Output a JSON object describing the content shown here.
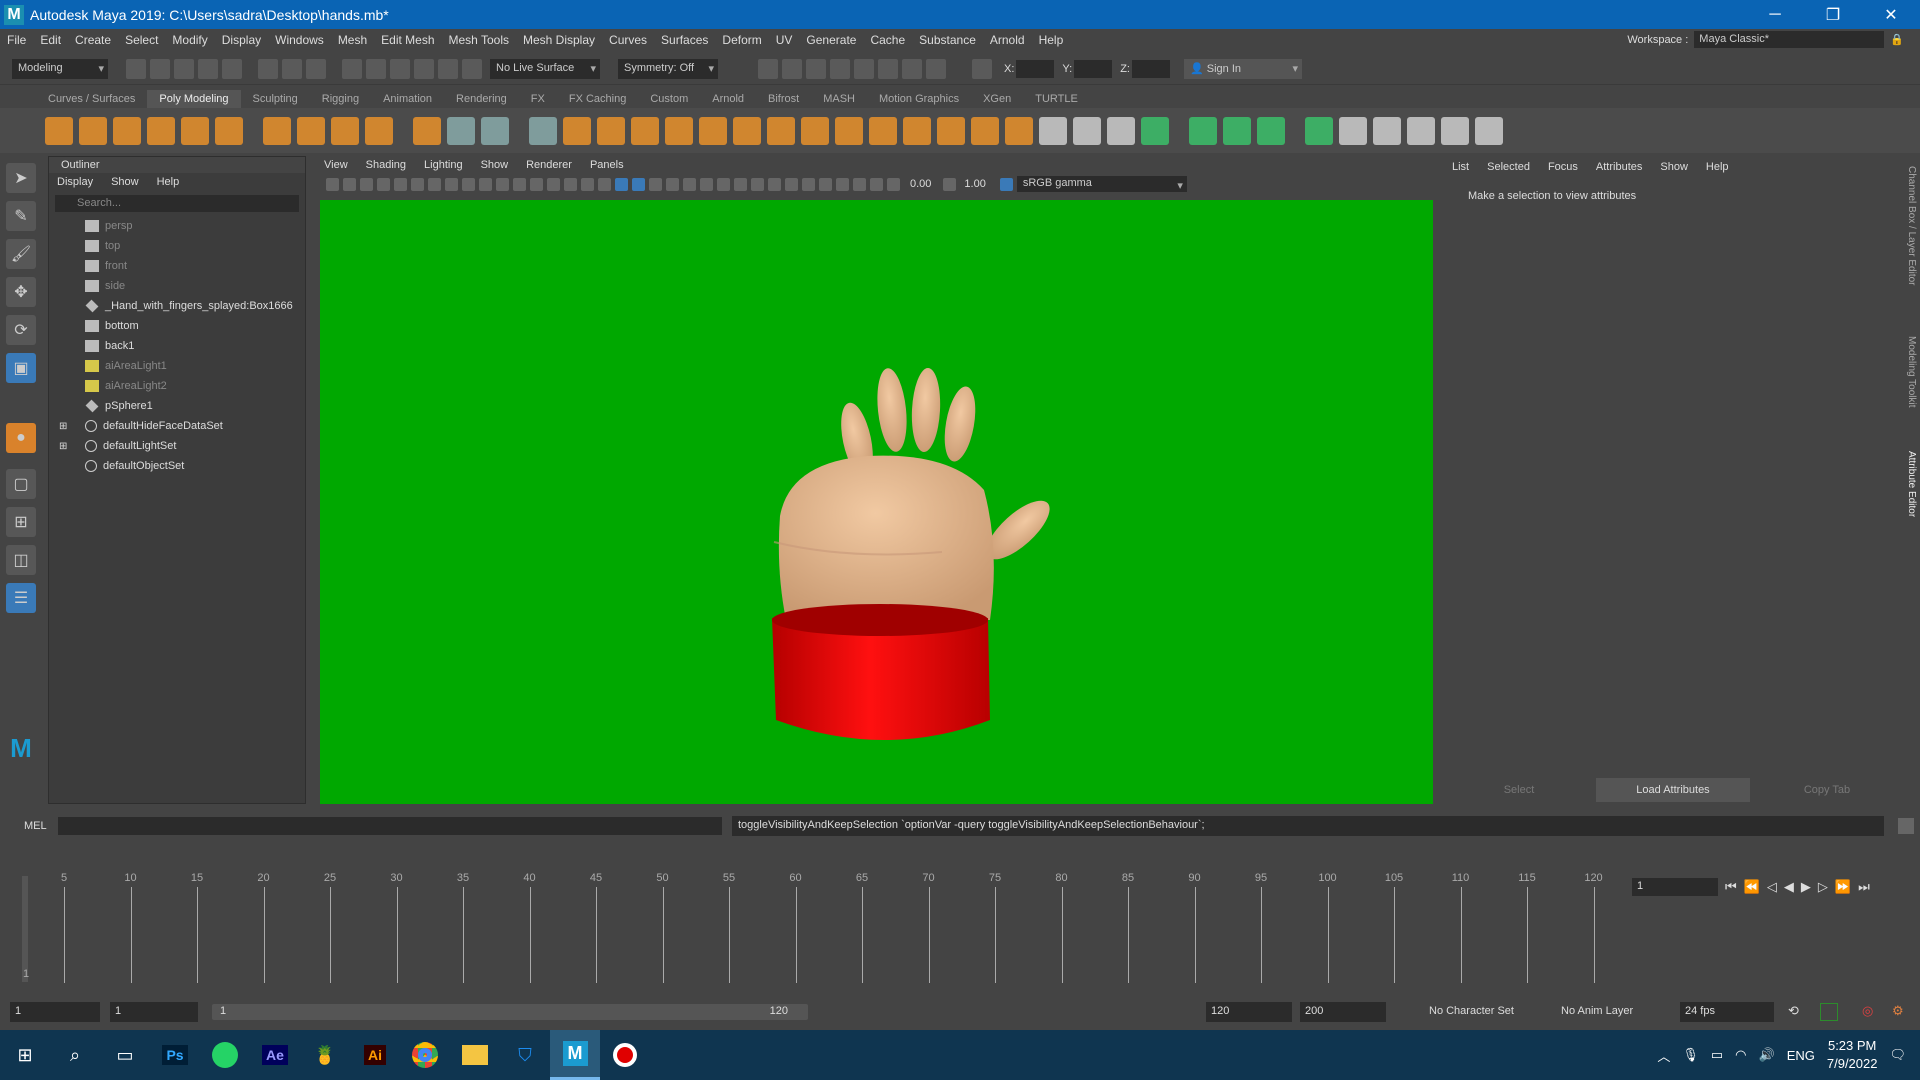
{
  "window": {
    "title": "Autodesk Maya 2019: C:\\Users\\sadra\\Desktop\\hands.mb*"
  },
  "menu": [
    "File",
    "Edit",
    "Create",
    "Select",
    "Modify",
    "Display",
    "Windows",
    "Mesh",
    "Edit Mesh",
    "Mesh Tools",
    "Mesh Display",
    "Curves",
    "Surfaces",
    "Deform",
    "UV",
    "Generate",
    "Cache",
    "Substance",
    "Arnold",
    "Help"
  ],
  "workspace": {
    "label": "Workspace :",
    "value": "Maya Classic*"
  },
  "statusline": {
    "mode": "Modeling",
    "live_surface": "No Live Surface",
    "symmetry": "Symmetry: Off",
    "x_label": "X:",
    "y_label": "Y:",
    "z_label": "Z:",
    "sign_in": "Sign In"
  },
  "shelf_tabs": [
    "Curves / Surfaces",
    "Poly Modeling",
    "Sculpting",
    "Rigging",
    "Animation",
    "Rendering",
    "FX",
    "FX Caching",
    "Custom",
    "Arnold",
    "Bifrost",
    "MASH",
    "Motion Graphics",
    "XGen",
    "TURTLE"
  ],
  "shelf_active": "Poly Modeling",
  "outliner": {
    "title": "Outliner",
    "menu": [
      "Display",
      "Show",
      "Help"
    ],
    "search_placeholder": "Search...",
    "items": [
      {
        "label": "persp",
        "dim": true,
        "icon": "camera-icon"
      },
      {
        "label": "top",
        "dim": true,
        "icon": "camera-icon"
      },
      {
        "label": "front",
        "dim": true,
        "icon": "camera-icon"
      },
      {
        "label": "side",
        "dim": true,
        "icon": "camera-icon"
      },
      {
        "label": "_Hand_with_fingers_splayed:Box1666",
        "dim": false,
        "icon": "mesh-icon"
      },
      {
        "label": "bottom",
        "dim": false,
        "icon": "camera-icon"
      },
      {
        "label": "back1",
        "dim": false,
        "icon": "camera-icon"
      },
      {
        "label": "aiAreaLight1",
        "dim": true,
        "icon": "light-icon"
      },
      {
        "label": "aiAreaLight2",
        "dim": true,
        "icon": "light-icon"
      },
      {
        "label": "pSphere1",
        "dim": false,
        "icon": "mesh-icon"
      },
      {
        "label": "defaultHideFaceDataSet",
        "dim": false,
        "icon": "set-icon",
        "expand": true
      },
      {
        "label": "defaultLightSet",
        "dim": false,
        "icon": "set-icon",
        "expand": true
      },
      {
        "label": "defaultObjectSet",
        "dim": false,
        "icon": "set-icon"
      }
    ]
  },
  "viewport": {
    "menu": [
      "View",
      "Shading",
      "Lighting",
      "Show",
      "Renderer",
      "Panels"
    ],
    "exposure": "0.00",
    "gamma": "1.00",
    "colorspace": "sRGB gamma",
    "bg_color": "#00a800"
  },
  "attribute_editor": {
    "menu": [
      "List",
      "Selected",
      "Focus",
      "Attributes",
      "Show",
      "Help"
    ],
    "message": "Make a selection to view attributes",
    "buttons": [
      "Select",
      "Load Attributes",
      "Copy Tab"
    ]
  },
  "side_tabs": [
    "Channel Box / Layer Editor",
    "Modeling Toolkit",
    "Attribute Editor"
  ],
  "command_line": {
    "label": "MEL",
    "output": "toggleVisibilityAndKeepSelection `optionVar -query toggleVisibilityAndKeepSelectionBehaviour`;"
  },
  "timeline": {
    "ticks": [
      "5",
      "10",
      "15",
      "20",
      "25",
      "30",
      "35",
      "40",
      "45",
      "50",
      "55",
      "60",
      "65",
      "70",
      "75",
      "80",
      "85",
      "90",
      "95",
      "100",
      "105",
      "110",
      "115",
      "120"
    ],
    "current": "1",
    "start_label": "1"
  },
  "range": {
    "start": "1",
    "playback_start": "1",
    "slider_start": "1",
    "slider_end": "120",
    "playback_end": "120",
    "end": "200",
    "character_set": "No Character Set",
    "anim_layer": "No Anim Layer",
    "fps": "24 fps"
  },
  "taskbar": {
    "lang": "ENG",
    "time": "5:23 PM",
    "date": "7/9/2022",
    "apps": [
      "windows-start-icon",
      "search-icon",
      "task-view-icon",
      "photoshop-icon",
      "whatsapp-icon",
      "after-effects-icon",
      "game-icon",
      "illustrator-icon",
      "chrome-icon",
      "file-explorer-icon",
      "shield-app-icon",
      "maya-icon",
      "recorder-icon"
    ]
  }
}
